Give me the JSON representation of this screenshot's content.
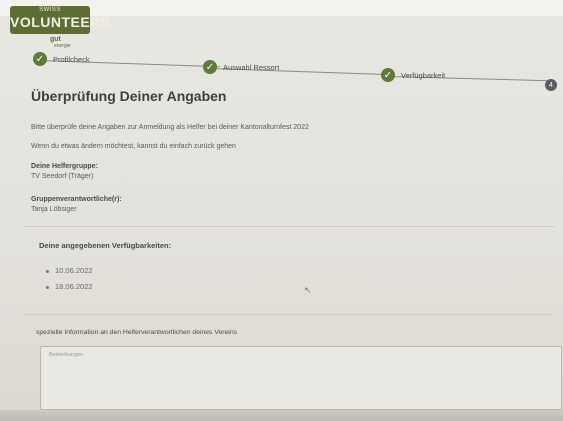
{
  "logo": {
    "top": "SWISS",
    "name": "VOLUNTEERS",
    "tagline": "gut",
    "tagline2": "energie"
  },
  "stepper": {
    "steps": [
      {
        "label": "Profilcheck",
        "state": "done"
      },
      {
        "label": "Auswahl Ressort",
        "state": "done"
      },
      {
        "label": "Verfügbarkeit",
        "state": "done"
      },
      {
        "label": "4",
        "state": "current"
      }
    ]
  },
  "page": {
    "title": "Überprüfung Deiner Angaben",
    "intro": "Bitte überprüfe deine Angaben zur Anmeldung als Helfer bei deiner Kantonalturnfest 2022",
    "intro2": "Wenn du etwas ändern möchtest, kannst du einfach zurück gehen",
    "group_label": "Deine Helfergruppe:",
    "group_value": "TV Seedorf (Träger)",
    "responsible_label": "Gruppenverantwortliche(r):",
    "responsible_value": "Tanja Löbsiger",
    "availability_title": "Deine angegebenen Verfügbarkeiten:",
    "dates": [
      "10.06.2022",
      "18.06.2022"
    ],
    "info_label": "spezielle Information an den Helferverantwortlichen deines Vereins",
    "textarea_placeholder": "Bemerkungen"
  },
  "colors": {
    "accent": "#5f7a3a",
    "logo_bg": "#5e6d33"
  }
}
